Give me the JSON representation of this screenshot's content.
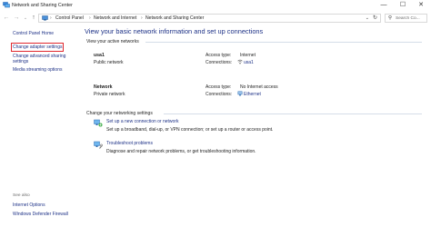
{
  "window": {
    "title": "Network and Sharing Center",
    "minimize_glyph": "—",
    "maximize_glyph": "☐",
    "close_glyph": "✕"
  },
  "nav": {
    "back_glyph": "←",
    "forward_glyph": "→",
    "recent_glyph": "⌄",
    "up_glyph": "↑"
  },
  "address": {
    "separator": "›",
    "crumbs": [
      "Control Panel",
      "Network and Internet",
      "Network and Sharing Center"
    ],
    "dropdown_glyph": "⌄",
    "refresh_glyph": "↻"
  },
  "search": {
    "placeholder": "Search Co...",
    "icon_glyph": "⚲"
  },
  "sidebar": {
    "home": "Control Panel Home",
    "items": [
      {
        "label": "Change adapter settings",
        "highlighted": true
      },
      {
        "label": "Change advanced sharing",
        "label2": "settings"
      },
      {
        "label": "Media streaming options"
      }
    ],
    "see_also_heading": "See also",
    "see_also": [
      "Internet Options",
      "Windows Defender Firewall"
    ]
  },
  "main": {
    "title": "View your basic network information and set up connections",
    "active_networks_label": "View your active networks",
    "networks": [
      {
        "name": "usa1",
        "category": "Public network",
        "access_type_label": "Access type:",
        "access_type": "Internet",
        "connections_label": "Connections:",
        "connection": "usa1",
        "connection_icon": "wifi-icon"
      },
      {
        "name": "Network",
        "category": "Private network",
        "access_type_label": "Access type:",
        "access_type": "No Internet access",
        "connections_label": "Connections:",
        "connection": "Ethernet",
        "connection_icon": "ethernet-icon"
      }
    ],
    "change_settings_label": "Change your networking settings",
    "tasks": [
      {
        "link": "Set up a new connection or network",
        "description": "Set up a broadband, dial-up, or VPN connection; or set up a router or access point.",
        "icon": "new-connection-icon"
      },
      {
        "link": "Troubleshoot problems",
        "description": "Diagnose and repair network problems, or get troubleshooting information.",
        "icon": "troubleshoot-icon"
      }
    ]
  },
  "colors": {
    "link": "#1e3287",
    "highlight_border": "#e0272d",
    "divider": "#d5dde8"
  }
}
